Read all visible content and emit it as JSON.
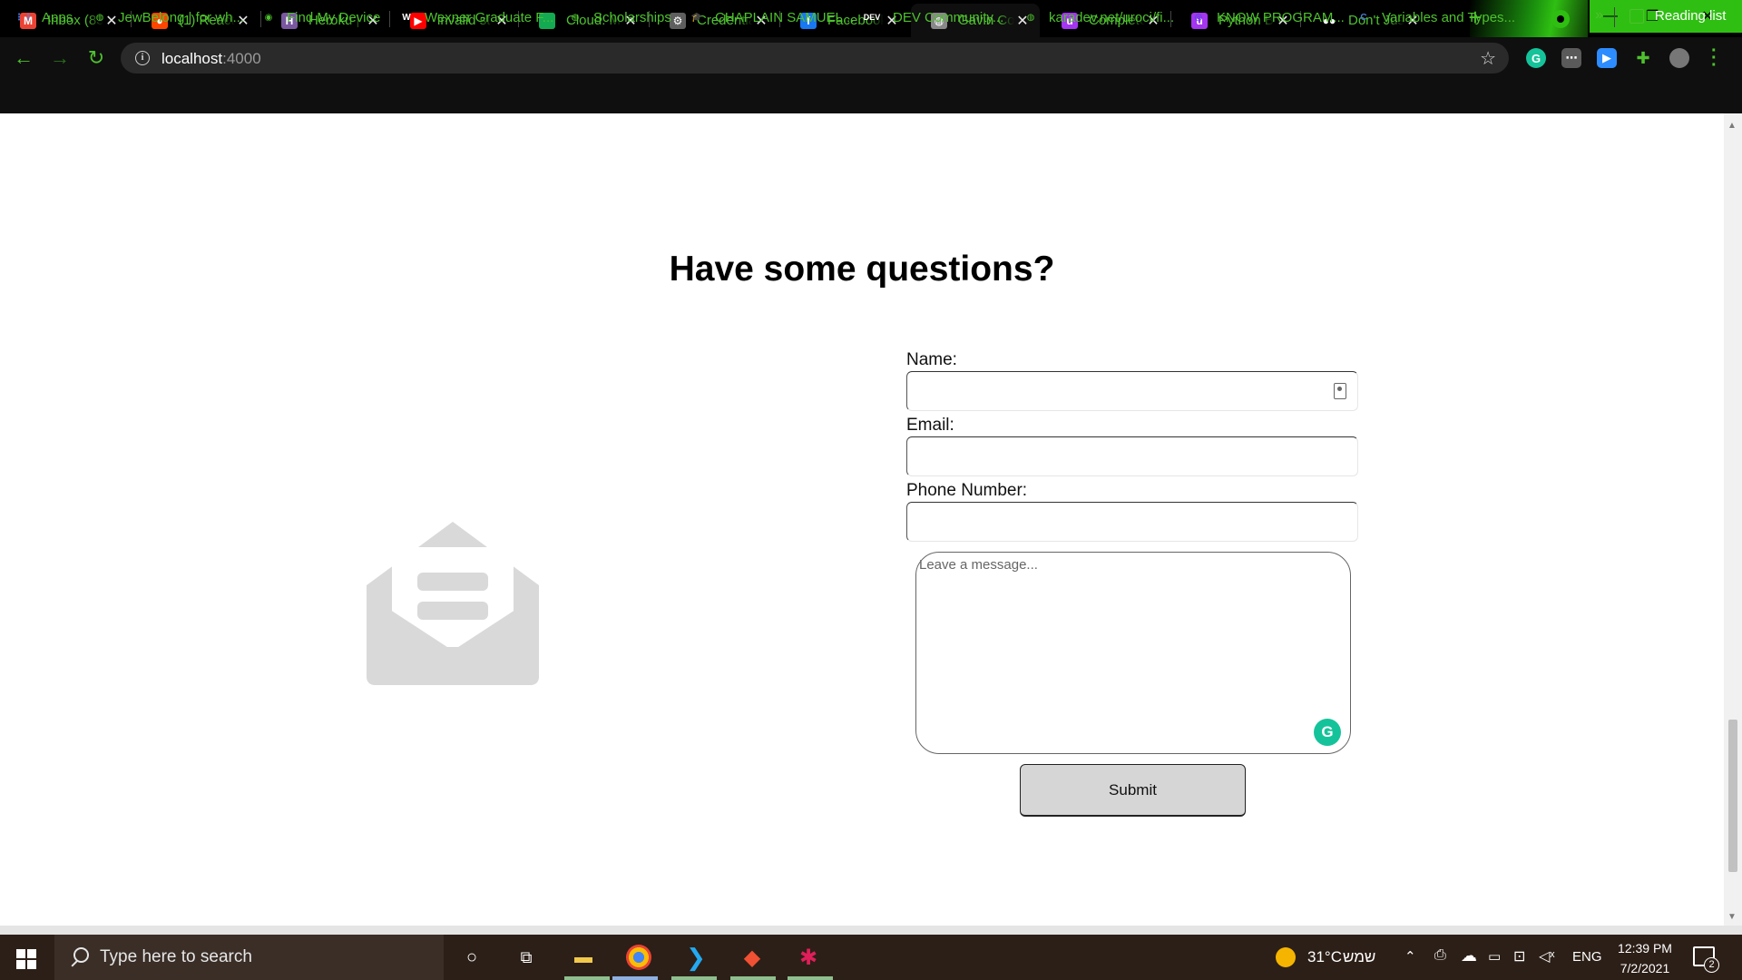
{
  "browser": {
    "tabs": [
      {
        "title": "Inbox (83",
        "icon": "gmail-icon",
        "favicon_text": "M",
        "favicon_color": "#ea4335"
      },
      {
        "title": "(1) React",
        "icon": "reddit-icon",
        "favicon_text": "●",
        "favicon_color": "#ff4500"
      },
      {
        "title": "Heroku | ",
        "icon": "heroku-icon",
        "favicon_text": "H",
        "favicon_color": "#79589f"
      },
      {
        "title": "invalid st",
        "icon": "youtube-icon",
        "favicon_text": "▶",
        "favicon_color": "#ff0000"
      },
      {
        "title": "Cloud: M",
        "icon": "mongodb-leaf-icon",
        "favicon_text": "",
        "favicon_color": "#13aa52"
      },
      {
        "title": "Credentia",
        "icon": "gear-icon",
        "favicon_text": "⚙",
        "favicon_color": "#5f5f5f"
      },
      {
        "title": "Facebook",
        "icon": "facebook-icon",
        "favicon_text": "f",
        "favicon_color": "#1877f2"
      },
      {
        "title": "Gavin Co",
        "icon": "globe-icon",
        "favicon_text": "◍",
        "favicon_color": "#888888"
      },
      {
        "title": "Complete",
        "icon": "udemy-icon",
        "favicon_text": "u",
        "favicon_color": "#a435f0"
      },
      {
        "title": "Python B",
        "icon": "udemy-icon",
        "favicon_text": "u",
        "favicon_color": "#a435f0"
      },
      {
        "title": "Don't Jus",
        "icon": "medium-icon",
        "favicon_text": "●●",
        "favicon_color": "#000000"
      }
    ],
    "close_glyph": "✕",
    "new_tab_glyph": "+",
    "window_controls": {
      "minimize": "—",
      "restore": "❐",
      "close": "✕"
    },
    "address": {
      "host": "localhost",
      "port": ":4000"
    },
    "toolbar_glyphs": {
      "back": "←",
      "forward": "→",
      "reload": "↻",
      "star": "☆",
      "info": "i"
    },
    "bookmarks": [
      {
        "label": "Apps",
        "icon": "apps-grid-icon"
      },
      {
        "label": "JewBelong | for wh...",
        "icon": "globe-icon"
      },
      {
        "label": "Find My Device",
        "icon": "find-device-icon"
      },
      {
        "label": "Wexner Graduate F...",
        "icon": "wexner-w-icon"
      },
      {
        "label": "Scholarships",
        "icon": "globe-icon"
      },
      {
        "label": "CHAPLAIN SAMUEL...",
        "icon": "graduation-cap-icon"
      },
      {
        "label": "DEV Community...",
        "icon": "dev-icon"
      },
      {
        "label": "karadev.net/uroci/fi...",
        "icon": "globe-icon"
      },
      {
        "label": "KNOW PROGRAM...",
        "icon": "know-program-icon"
      },
      {
        "label": "Variables and Types...",
        "icon": "c-icon"
      }
    ],
    "bookmarks_overflow": "»",
    "reading_list": "Reading list",
    "accent_color": "#4ec12e"
  },
  "page": {
    "heading": "Have some questions?",
    "form": {
      "name_label": "Name:",
      "email_label": "Email:",
      "phone_label": "Phone Number:",
      "message_placeholder": "Leave a message...",
      "submit_label": "Submit"
    },
    "illustration_icon": "open-envelope-icon",
    "illustration_color": "#d9d9d9"
  },
  "taskbar": {
    "search_placeholder": "Type here to search",
    "weather": "31°C",
    "weather_text": "שמש",
    "language": "ENG",
    "time": "12:39 PM",
    "date": "7/2/2021",
    "notification_count": "2",
    "apps": [
      "cortana-icon",
      "task-view-icon",
      "file-explorer-icon",
      "chrome-icon",
      "vscode-icon",
      "git-icon",
      "slack-icon"
    ]
  }
}
